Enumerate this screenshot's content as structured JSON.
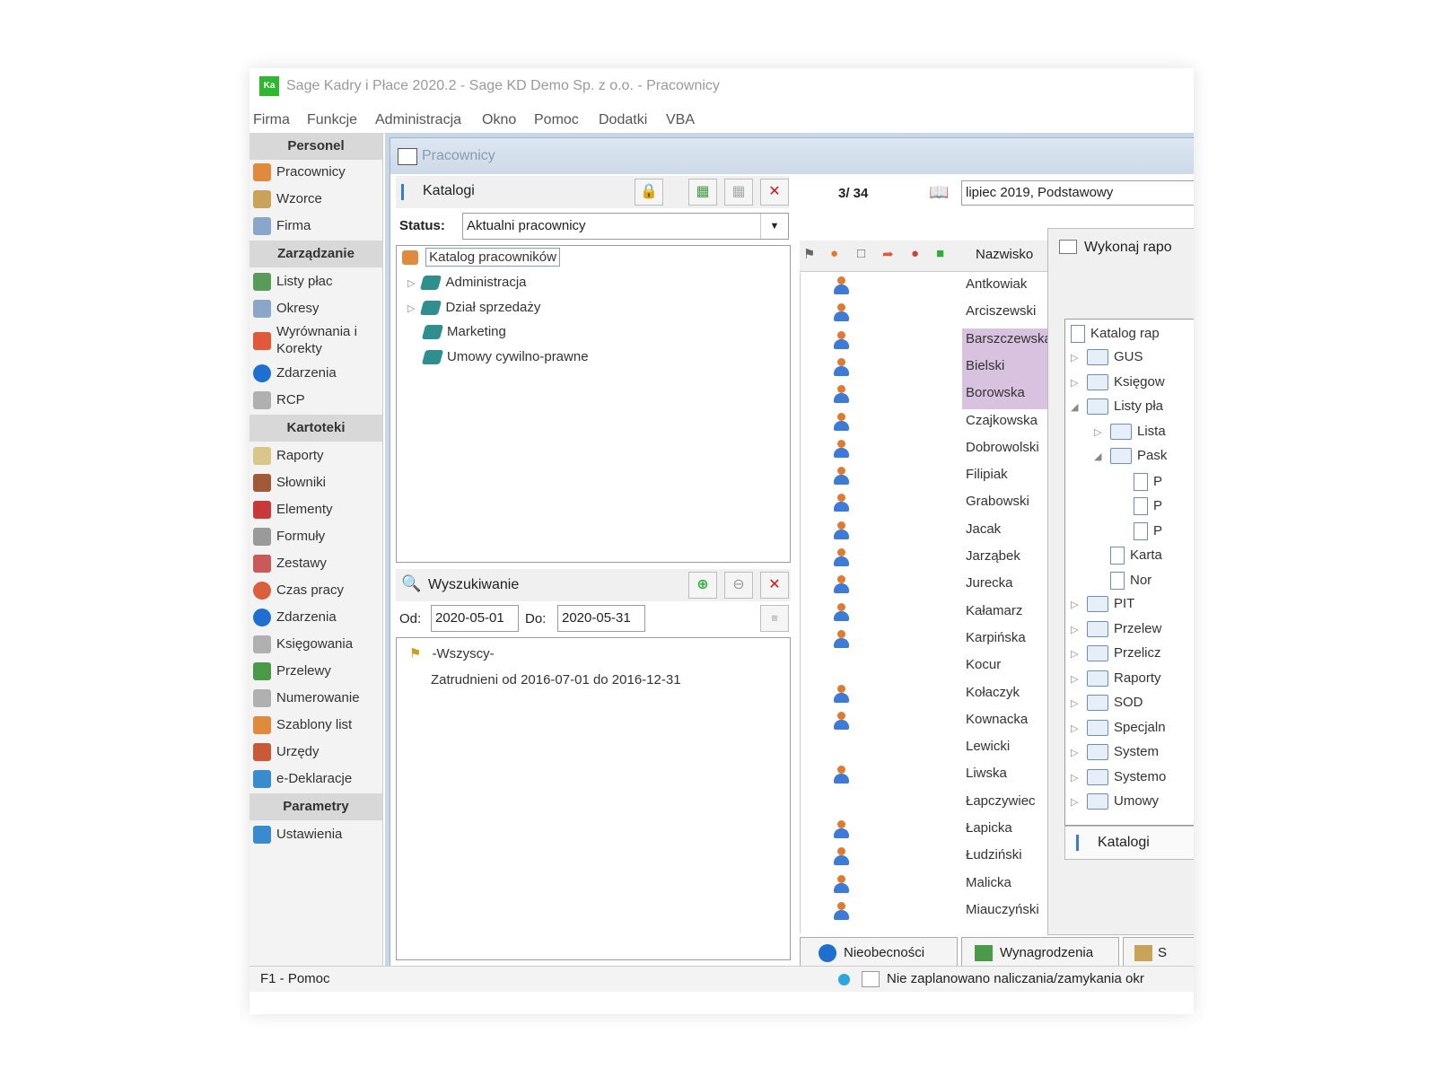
{
  "window": {
    "title": "Sage Kadry i Płace 2020.2 - Sage KD Demo Sp. z o.o. - Pracownicy",
    "app_icon_text": "Ka"
  },
  "menu": [
    "Firma",
    "Funkcje",
    "Administracja",
    "Okno",
    "Pomoc",
    "Dodatki",
    "VBA"
  ],
  "sidebar": {
    "sections": [
      {
        "title": "Personel",
        "items": [
          "Pracownicy",
          "Wzorce",
          "Firma"
        ]
      },
      {
        "title": "Zarządzanie",
        "items": [
          "Listy płac",
          "Okresy",
          "Wyrównania i Korekty",
          "Zdarzenia",
          "RCP"
        ]
      },
      {
        "title": "Kartoteki",
        "items": [
          "Raporty",
          "Słowniki",
          "Elementy",
          "Formuły",
          "Zestawy",
          "Czas pracy",
          "Zdarzenia",
          "Księgowania",
          "Przelewy",
          "Numerowanie",
          "Szablony list",
          "Urzędy",
          "e-Deklaracje"
        ]
      },
      {
        "title": "Parametry",
        "items": [
          "Ustawienia"
        ]
      }
    ]
  },
  "child_window": {
    "title": "Pracownicy"
  },
  "catalogs": {
    "label": "Katalogi",
    "status_label": "Status:",
    "status_value": "Aktualni pracownicy",
    "root": "Katalog pracowników",
    "items": [
      "Administracja",
      "Dział sprzedaży",
      "Marketing",
      "Umowy cywilno-prawne"
    ]
  },
  "search": {
    "label": "Wyszukiwanie",
    "from_label": "Od:",
    "from_value": "2020-05-01",
    "to_label": "Do:",
    "to_value": "2020-05-31",
    "all_label": "-Wszyscy-",
    "filter_text": "Zatrudnieni od 2016-07-01 do 2016-12-31"
  },
  "employees": {
    "count": "3/ 34",
    "period": "lipiec 2019, Podstawowy",
    "column_header": "Nazwisko",
    "rows": [
      {
        "name": "Antkowiak",
        "icon": true,
        "selected": false
      },
      {
        "name": "Arciszewski",
        "icon": true,
        "selected": false
      },
      {
        "name": "Barszczewska",
        "icon": true,
        "selected": true
      },
      {
        "name": "Bielski",
        "icon": true,
        "selected": true
      },
      {
        "name": "Borowska",
        "icon": true,
        "selected": true
      },
      {
        "name": "Czajkowska",
        "icon": true,
        "selected": false
      },
      {
        "name": "Dobrowolski",
        "icon": true,
        "selected": false
      },
      {
        "name": "Filipiak",
        "icon": true,
        "selected": false
      },
      {
        "name": "Grabowski",
        "icon": true,
        "selected": false
      },
      {
        "name": "Jacak",
        "icon": true,
        "selected": false
      },
      {
        "name": "Jarząbek",
        "icon": true,
        "selected": false
      },
      {
        "name": "Jurecka",
        "icon": true,
        "selected": false
      },
      {
        "name": "Kałamarz",
        "icon": true,
        "selected": false
      },
      {
        "name": "Karpińska",
        "icon": true,
        "selected": false
      },
      {
        "name": "Kocur",
        "icon": false,
        "selected": false
      },
      {
        "name": "Kołaczyk",
        "icon": true,
        "selected": false
      },
      {
        "name": "Kownacka",
        "icon": true,
        "selected": false
      },
      {
        "name": "Lewicki",
        "icon": false,
        "selected": false
      },
      {
        "name": "Liwska",
        "icon": true,
        "selected": false
      },
      {
        "name": "Łapczywiec",
        "icon": false,
        "selected": false
      },
      {
        "name": "Łapicka",
        "icon": true,
        "selected": false
      },
      {
        "name": "Łudziński",
        "icon": true,
        "selected": false
      },
      {
        "name": "Malicka",
        "icon": true,
        "selected": false
      },
      {
        "name": "Miauczyński",
        "icon": true,
        "selected": false
      }
    ]
  },
  "reports": {
    "title": "Wykonaj rapo",
    "root": "Katalog rap",
    "tree": [
      {
        "label": "GUS",
        "level": 1,
        "type": "folder",
        "expander": "▷"
      },
      {
        "label": "Księgow",
        "level": 1,
        "type": "folder",
        "expander": "▷"
      },
      {
        "label": "Listy pła",
        "level": 1,
        "type": "folder",
        "expander": "◢"
      },
      {
        "label": "Lista",
        "level": 2,
        "type": "folder",
        "expander": "▷"
      },
      {
        "label": "Pask",
        "level": 2,
        "type": "folder",
        "expander": "◢"
      },
      {
        "label": "P",
        "level": 3,
        "type": "doc",
        "expander": ""
      },
      {
        "label": "P",
        "level": 3,
        "type": "doc",
        "expander": ""
      },
      {
        "label": "P",
        "level": 3,
        "type": "doc",
        "expander": ""
      },
      {
        "label": "Karta",
        "level": 2,
        "type": "doc",
        "expander": ""
      },
      {
        "label": "Nor",
        "level": 2,
        "type": "doc",
        "expander": ""
      },
      {
        "label": "PIT",
        "level": 1,
        "type": "folder",
        "expander": "▷"
      },
      {
        "label": "Przelew",
        "level": 1,
        "type": "folder",
        "expander": "▷"
      },
      {
        "label": "Przelicz",
        "level": 1,
        "type": "folder",
        "expander": "▷"
      },
      {
        "label": "Raporty",
        "level": 1,
        "type": "folder",
        "expander": "▷"
      },
      {
        "label": "SOD",
        "level": 1,
        "type": "folder",
        "expander": "▷"
      },
      {
        "label": "Specjaln",
        "level": 1,
        "type": "folder",
        "expander": "▷"
      },
      {
        "label": "System",
        "level": 1,
        "type": "folder",
        "expander": "▷"
      },
      {
        "label": "Systemo",
        "level": 1,
        "type": "folder",
        "expander": "▷"
      },
      {
        "label": "Umowy",
        "level": 1,
        "type": "folder",
        "expander": "▷"
      }
    ],
    "tab_label": "Katalogi"
  },
  "bottom_tabs": [
    "Nieobecności",
    "Wynagrodzenia",
    "S"
  ],
  "statusbar": {
    "help": "F1 - Pomoc",
    "message": "Nie zaplanowano naliczania/zamykania okr"
  },
  "colors": {
    "selection": "#d9c2e0",
    "sidebar_header": "#d8d8d8",
    "title_gradient": "#cdd9e8",
    "person_head": "#e07a2e",
    "person_body": "#3d7bd6",
    "close_red": "#dd1111",
    "add_green": "#2fae3a"
  }
}
